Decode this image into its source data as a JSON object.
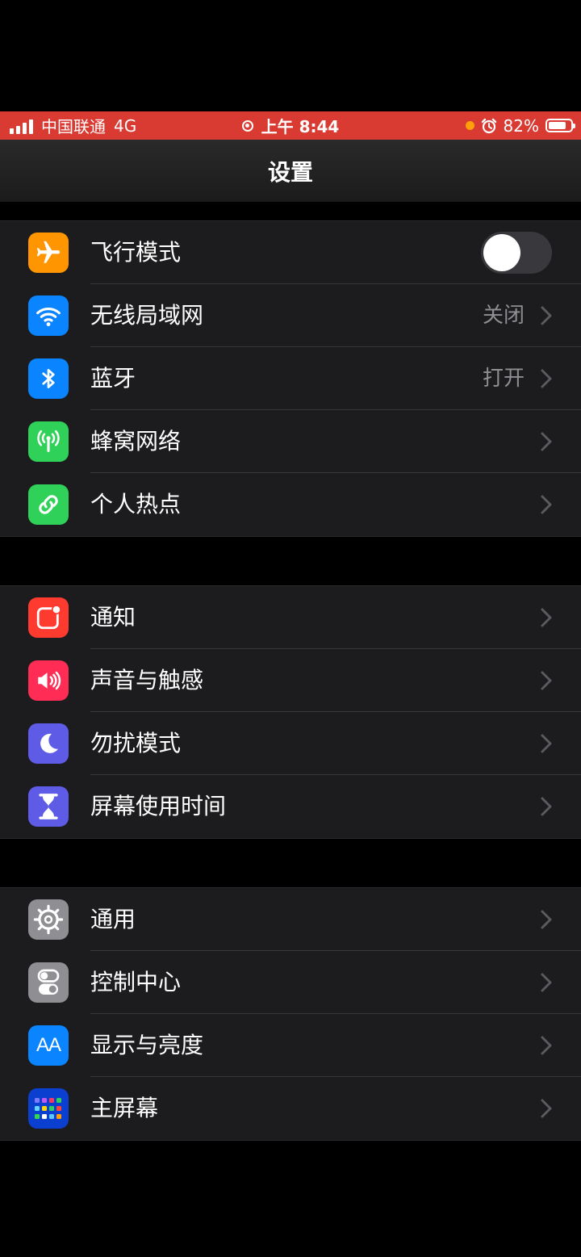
{
  "status_bar": {
    "carrier": "中国联通",
    "network": "4G",
    "time": "上午 8:44",
    "battery": "82%",
    "battery_level": 0.82,
    "bar_color": "#d93a32"
  },
  "nav": {
    "title": "设置"
  },
  "groups": [
    {
      "rows": [
        {
          "label": "飞行模式",
          "icon": "airplane-icon",
          "icon_color": "#ff9500",
          "toggle": false
        },
        {
          "label": "无线局域网",
          "icon": "wifi-icon",
          "icon_color": "#0a84ff",
          "value": "关闭"
        },
        {
          "label": "蓝牙",
          "icon": "bluetooth-icon",
          "icon_color": "#0a84ff",
          "value": "打开"
        },
        {
          "label": "蜂窝网络",
          "icon": "antenna-icon",
          "icon_color": "#30d158"
        },
        {
          "label": "个人热点",
          "icon": "chain-link-icon",
          "icon_color": "#30d158"
        }
      ]
    },
    {
      "rows": [
        {
          "label": "通知",
          "icon": "notification-icon",
          "icon_color": "#ff3b30"
        },
        {
          "label": "声音与触感",
          "icon": "speaker-icon",
          "icon_color": "#ff2d55"
        },
        {
          "label": "勿扰模式",
          "icon": "moon-icon",
          "icon_color": "#5e5ce6"
        },
        {
          "label": "屏幕使用时间",
          "icon": "hourglass-icon",
          "icon_color": "#5e5ce6"
        }
      ]
    },
    {
      "rows": [
        {
          "label": "通用",
          "icon": "gear-icon",
          "icon_color": "#8e8e93"
        },
        {
          "label": "控制中心",
          "icon": "switches-icon",
          "icon_color": "#8e8e93"
        },
        {
          "label": "显示与亮度",
          "icon": "text-size-icon",
          "icon_color": "#0a84ff",
          "icon_text": "AA"
        },
        {
          "label": "主屏幕",
          "icon": "home-grid-icon",
          "icon_color": "#0a3fd0"
        }
      ]
    }
  ]
}
